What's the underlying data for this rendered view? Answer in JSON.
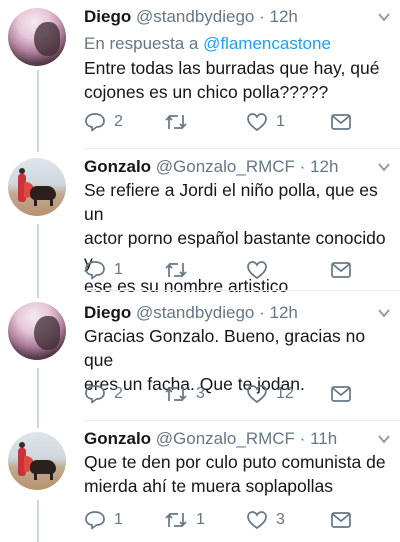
{
  "tweets": [
    {
      "name": "Diego",
      "handle": "@standbydiego",
      "dot": "·",
      "time": "12h",
      "reply_prefix": "En respuesta a",
      "reply_to": "@flamencastone",
      "text_lines": [
        "Entre todas las burradas que hay, qué",
        "cojones es un chico polla?????"
      ],
      "replies": "2",
      "retweets": "",
      "likes": "1"
    },
    {
      "name": "Gonzalo",
      "handle": "@Gonzalo_RMCF",
      "dot": "·",
      "time": "12h",
      "text_lines": [
        "Se refiere a Jordi el niño polla, que es un",
        "actor porno español bastante conocido y",
        "ese es su nombre artistico"
      ],
      "replies": "1",
      "retweets": "",
      "likes": ""
    },
    {
      "name": "Diego",
      "handle": "@standbydiego",
      "dot": "·",
      "time": "12h",
      "text_lines": [
        "Gracias Gonzalo. Bueno, gracias no que",
        "eres un facha. Que te jodan."
      ],
      "replies": "2",
      "retweets": "3",
      "likes": "12"
    },
    {
      "name": "Gonzalo",
      "handle": "@Gonzalo_RMCF",
      "dot": "·",
      "time": "11h",
      "text_lines": [
        "Que te den por culo puto comunista de",
        "mierda ahí te muera soplapollas"
      ],
      "replies": "1",
      "retweets": "1",
      "likes": "3"
    }
  ],
  "icons": {
    "reply": "reply-icon",
    "retweet": "retweet-icon",
    "like": "heart-icon",
    "dm": "envelope-icon",
    "caret": "chevron-down-icon"
  },
  "colors": {
    "text": "#14171a",
    "meta": "#657786",
    "link": "#1da1f2",
    "line": "#ccd6dd"
  }
}
